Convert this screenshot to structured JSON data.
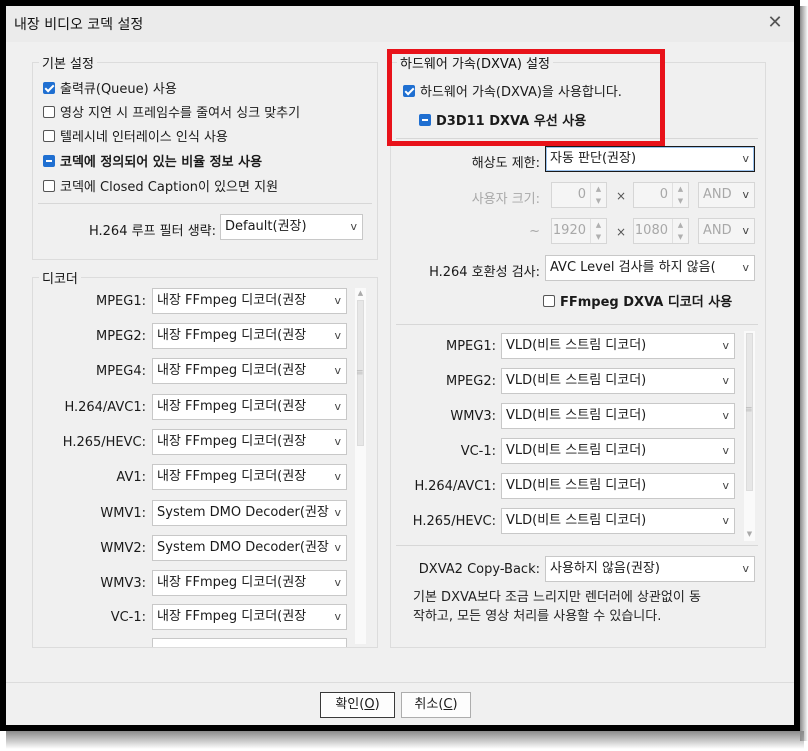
{
  "window": {
    "title": "내장 비디오 코덱 설정"
  },
  "basic": {
    "title": "기본 설정",
    "options": [
      {
        "label": "출력큐(Queue) 사용",
        "state": "checked",
        "bold": false
      },
      {
        "label": "영상 지연 시 프레임수를 줄여서 싱크 맞추기",
        "state": "unchecked",
        "bold": false
      },
      {
        "label": "텔레시네 인터레이스 인식 사용",
        "state": "unchecked",
        "bold": false
      },
      {
        "label": "코덱에 정의되어 있는 비율 정보 사용",
        "state": "indeterminate",
        "bold": true
      },
      {
        "label": "코덱에 Closed Caption이 있으면 지원",
        "state": "unchecked",
        "bold": false
      }
    ],
    "h264_loop_label": "H.264 루프 필터 생략:",
    "h264_loop_value": "Default(권장)"
  },
  "decoder": {
    "title": "디코더",
    "rows": [
      {
        "label": "MPEG1:",
        "value": "내장 FFmpeg 디코더(권장"
      },
      {
        "label": "MPEG2:",
        "value": "내장 FFmpeg 디코더(권장"
      },
      {
        "label": "MPEG4:",
        "value": "내장 FFmpeg 디코더(권장"
      },
      {
        "label": "H.264/AVC1:",
        "value": "내장 FFmpeg 디코더(권장"
      },
      {
        "label": "H.265/HEVC:",
        "value": "내장 FFmpeg 디코더(권장"
      },
      {
        "label": "AV1:",
        "value": "내장 FFmpeg 디코더(권장"
      },
      {
        "label": "WMV1:",
        "value": "System DMO Decoder(권장"
      },
      {
        "label": "WMV2:",
        "value": "System DMO Decoder(권장"
      },
      {
        "label": "WMV3:",
        "value": "내장 FFmpeg 디코더(권장"
      },
      {
        "label": "VC-1:",
        "value": "내장 FFmpeg 디코더(권장"
      }
    ]
  },
  "hw": {
    "title": "하드웨어 가속(DXVA) 설정",
    "use_dxva": "하드웨어 가속(DXVA)을 사용합니다.",
    "d3d11": "D3D11 DXVA 우선 사용",
    "resolution_label": "해상도 제한:",
    "resolution_value": "자동 판단(권장)",
    "user_size_label": "사용자 크기:",
    "user_w": "0",
    "user_h": "0",
    "user_op": "AND",
    "tilde": "~",
    "max_w": "1920",
    "max_h": "1080",
    "max_op": "AND",
    "times": "×",
    "h264_compat_label": "H.264 호환성 검사:",
    "h264_compat_value": "AVC Level 검사를 하지 않음(",
    "ffmpeg_dxva": "FFmpeg DXVA 디코더 사용",
    "codecs": [
      {
        "label": "MPEG1:",
        "value": "VLD(비트 스트림 디코더)"
      },
      {
        "label": "MPEG2:",
        "value": "VLD(비트 스트림 디코더)"
      },
      {
        "label": "WMV3:",
        "value": "VLD(비트 스트림 디코더)"
      },
      {
        "label": "VC-1:",
        "value": "VLD(비트 스트림 디코더)"
      },
      {
        "label": "H.264/AVC1:",
        "value": "VLD(비트 스트림 디코더)"
      },
      {
        "label": "H.265/HEVC:",
        "value": "VLD(비트 스트림 디코더)"
      }
    ],
    "copyback_label": "DXVA2 Copy-Back:",
    "copyback_value": "사용하지 않음(권장)",
    "desc_line1": "기본 DXVA보다 조금 느리지만 렌더러에 상관없이 동",
    "desc_line2": "작하고, 모든 영상 처리를 사용할 수 있습니다."
  },
  "footer": {
    "ok_text": "확인(",
    "ok_key": "O",
    "ok_end": ")",
    "cancel_text": "취소(",
    "cancel_key": "C",
    "cancel_end": ")"
  },
  "colors": {
    "accent": "#1f6fd1",
    "highlight": "#e8121a"
  }
}
